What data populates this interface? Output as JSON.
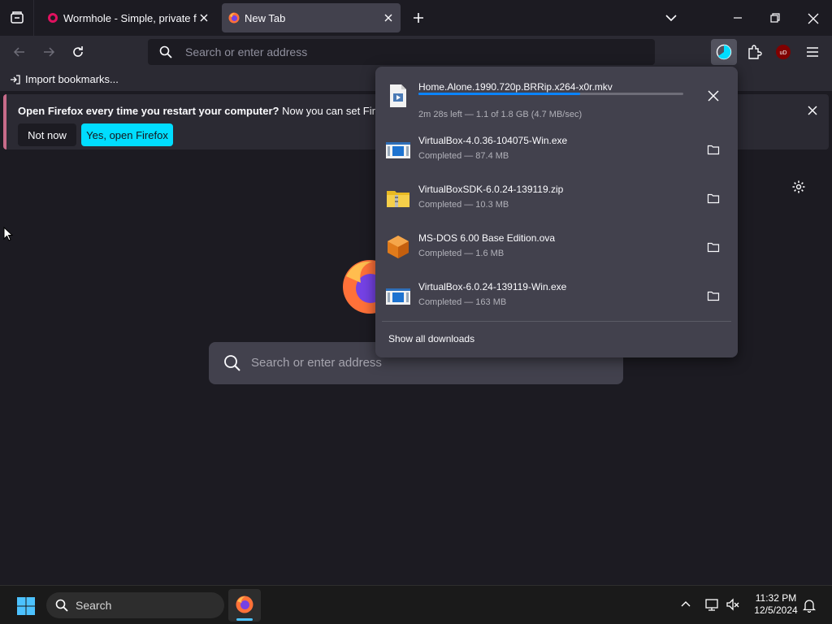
{
  "tabs": [
    {
      "title": "Wormhole - Simple, private file sharing",
      "favicon": "wormhole-icon",
      "active": false
    },
    {
      "title": "New Tab",
      "favicon": "firefox-icon",
      "active": true
    }
  ],
  "toolbar": {
    "url_placeholder": "Search or enter address"
  },
  "bookmarks": {
    "import_label": "Import bookmarks..."
  },
  "notification": {
    "bold_text": "Open Firefox every time you restart your computer?",
    "text": " Now you can set Firefox to o",
    "not_now_label": "Not now",
    "yes_label": "Yes, open Firefox"
  },
  "newtab": {
    "search_placeholder": "Search or enter address"
  },
  "downloads": {
    "items": [
      {
        "name": "Home.Alone.1990.720p.BRRip.x264-x0r.mkv",
        "status": "2m 28s left — 1.1 of 1.8 GB (4.7 MB/sec)",
        "progress": 0.61,
        "icon": "video-file-icon",
        "action": "cancel-icon"
      },
      {
        "name": "VirtualBox-4.0.36-104075-Win.exe",
        "status": "Completed — 87.4 MB",
        "icon": "exe-file-icon",
        "action": "folder-icon"
      },
      {
        "name": "VirtualBoxSDK-6.0.24-139119.zip",
        "status": "Completed — 10.3 MB",
        "icon": "zip-file-icon",
        "action": "folder-icon"
      },
      {
        "name": "MS-DOS 6.00 Base Edition.ova",
        "status": "Completed — 1.6 MB",
        "icon": "ova-file-icon",
        "action": "folder-icon"
      },
      {
        "name": "VirtualBox-6.0.24-139119-Win.exe",
        "status": "Completed — 163 MB",
        "icon": "exe-file-icon",
        "action": "folder-icon"
      }
    ],
    "show_all_label": "Show all downloads"
  },
  "taskbar": {
    "search_label": "Search",
    "time": "11:32 PM",
    "date": "12/5/2024"
  },
  "colors": {
    "accent": "#00ddff",
    "progress": "#0a84ff",
    "panel": "#42414d",
    "toolbar": "#2b2a33",
    "background": "#1c1b22"
  }
}
